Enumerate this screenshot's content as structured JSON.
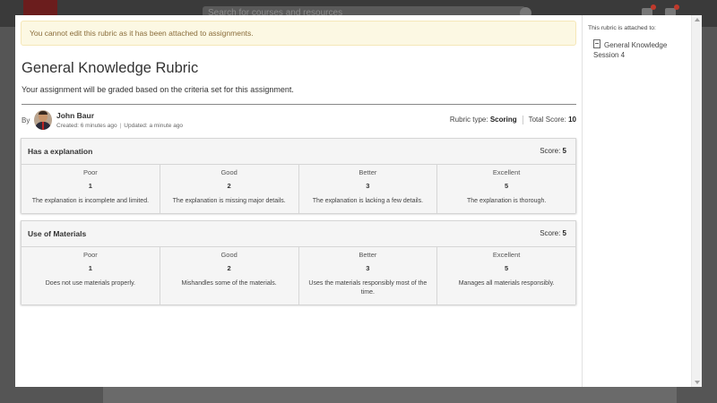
{
  "background": {
    "search_placeholder": "Search for courses and resources"
  },
  "alert": {
    "text": "You cannot edit this rubric as it has been attached to assignments."
  },
  "rubric": {
    "title": "General Knowledge Rubric",
    "description": "Your assignment will be graded based on the criteria set for this assignment.",
    "by_label": "By",
    "author": "John Baur",
    "created": "Created: 6 minutes ago",
    "updated": "Updated: a minute ago",
    "rubric_type_label": "Rubric type:",
    "rubric_type": "Scoring",
    "total_score_label": "Total Score:",
    "total_score": "10"
  },
  "criteria": [
    {
      "title": "Has a explanation",
      "score_label": "Score:",
      "score": "5",
      "levels": [
        {
          "name": "Poor",
          "points": "1",
          "description": "The explanation is incomplete and limited."
        },
        {
          "name": "Good",
          "points": "2",
          "description": "The explanation is missing major details."
        },
        {
          "name": "Better",
          "points": "3",
          "description": "The explanation is lacking a few details."
        },
        {
          "name": "Excellent",
          "points": "5",
          "description": "The explanation is thorough."
        }
      ]
    },
    {
      "title": "Use of Materials",
      "score_label": "Score:",
      "score": "5",
      "levels": [
        {
          "name": "Poor",
          "points": "1",
          "description": "Does not use materials properly."
        },
        {
          "name": "Good",
          "points": "2",
          "description": "Mishandles some of the materials."
        },
        {
          "name": "Better",
          "points": "3",
          "description": "Uses the materials responsibly most of the time."
        },
        {
          "name": "Excellent",
          "points": "5",
          "description": "Manages all materials responsibly."
        }
      ]
    }
  ],
  "sidebar": {
    "title": "This rubric is attached to:",
    "attachment": "General Knowledge Session 4",
    "attachment_icon": "document-icon"
  },
  "colors": {
    "alert_bg": "#fcf8e3",
    "alert_text": "#8a6d3b",
    "header_bg": "#f5f5f5"
  }
}
